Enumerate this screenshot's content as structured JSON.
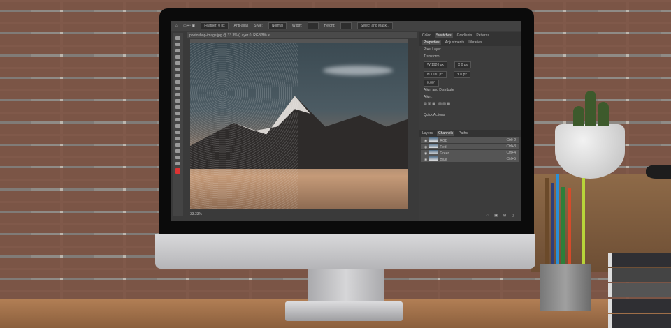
{
  "options_bar": {
    "feather": "Feather: 0 px",
    "anti_alias": "Anti-alias",
    "style_label": "Style:",
    "style_value": "Normal",
    "width": "Width:",
    "height": "Height:",
    "select_mask": "Select and Mask..."
  },
  "document": {
    "tab_title": "photoshop-image.jpg @ 33.3% (Layer 0, RGB/8#) ×",
    "zoom": "33.33%"
  },
  "panels": {
    "top_tabs": [
      "Color",
      "Swatches",
      "Gradients",
      "Patterns"
    ],
    "prop_tabs": [
      "Properties",
      "Adjustments",
      "Libraries"
    ],
    "layer_type": "Pixel Layer",
    "transform": "Transform",
    "w": "W 1920 px",
    "h": "H 1280 px",
    "x": "X 0 px",
    "y": "Y 0 px",
    "angle": "0.00°",
    "align": "Align and Distribute",
    "align_label": "Align:",
    "quick": "Quick Actions",
    "bottom_tabs": [
      "Layers",
      "Channels",
      "Paths"
    ],
    "channels": [
      {
        "name": "RGB",
        "shortcut": "Ctrl+2"
      },
      {
        "name": "Red",
        "shortcut": "Ctrl+3"
      },
      {
        "name": "Green",
        "shortcut": "Ctrl+4"
      },
      {
        "name": "Blue",
        "shortcut": "Ctrl+5"
      }
    ]
  }
}
